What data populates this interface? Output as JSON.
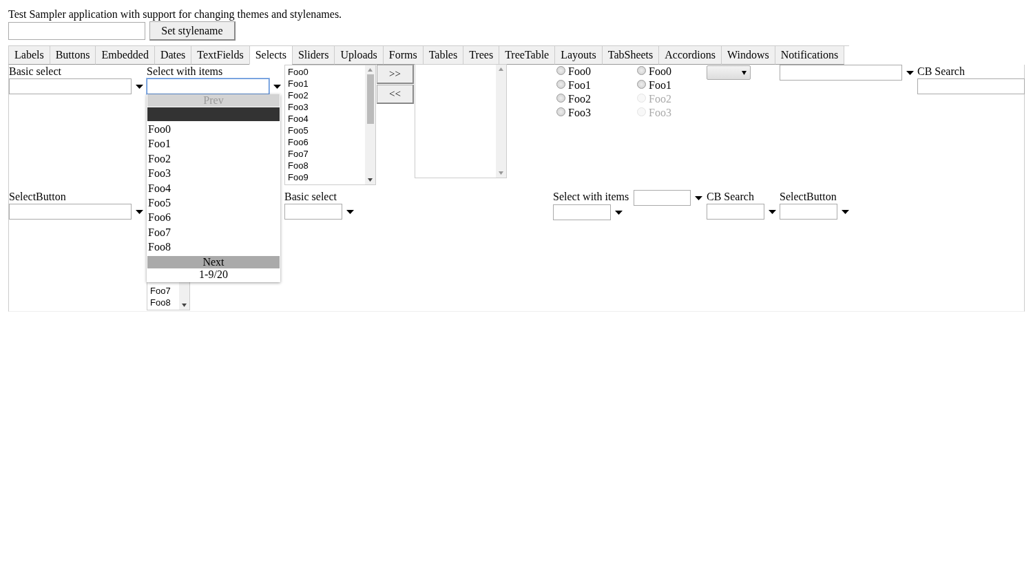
{
  "intro": "Test Sampler application with support for changing themes and stylenames.",
  "set_stylename_button": "Set stylename",
  "tabs": [
    {
      "label": "Labels",
      "selected": false
    },
    {
      "label": "Buttons",
      "selected": false
    },
    {
      "label": "Embedded",
      "selected": false
    },
    {
      "label": "Dates",
      "selected": false
    },
    {
      "label": "TextFields",
      "selected": false
    },
    {
      "label": "Selects",
      "selected": true
    },
    {
      "label": "Sliders",
      "selected": false
    },
    {
      "label": "Uploads",
      "selected": false
    },
    {
      "label": "Forms",
      "selected": false
    },
    {
      "label": "Tables",
      "selected": false
    },
    {
      "label": "Trees",
      "selected": false
    },
    {
      "label": "TreeTable",
      "selected": false
    },
    {
      "label": "Layouts",
      "selected": false
    },
    {
      "label": "TabSheets",
      "selected": false
    },
    {
      "label": "Accordions",
      "selected": false
    },
    {
      "label": "Windows",
      "selected": false
    },
    {
      "label": "Notifications",
      "selected": false
    }
  ],
  "row_1": [
    {
      "kind": "select",
      "caption": "Basic select",
      "focused": false
    },
    {
      "kind": "select",
      "caption": "Select with items",
      "focused": true,
      "popup": {
        "prev": {
          "label": "Prev",
          "disabled": true
        },
        "items": [
          {
            "selected": true
          },
          {
            "label": "Foo0",
            "selected": false
          },
          {
            "label": "Foo1",
            "selected": false
          },
          {
            "label": "Foo2",
            "selected": false
          },
          {
            "label": "Foo3",
            "selected": false
          },
          {
            "label": "Foo4",
            "selected": false
          },
          {
            "label": "Foo5",
            "selected": false
          },
          {
            "label": "Foo6",
            "selected": false
          },
          {
            "label": "Foo7",
            "selected": false
          },
          {
            "label": "Foo8",
            "selected": false
          }
        ],
        "next": {
          "label": "Next",
          "disabled": false
        },
        "status": "1-9/20"
      }
    },
    {
      "kind": "listbox",
      "items": [
        "Foo0",
        "Foo1",
        "Foo2",
        "Foo3",
        "Foo4",
        "Foo5",
        "Foo6",
        "Foo7",
        "Foo8",
        "Foo9"
      ]
    },
    {
      "kind": "buttons",
      "buttons": [
        ">>",
        "<<"
      ]
    },
    {
      "kind": "listbox"
    },
    {
      "kind": "radio_group",
      "options": [
        {
          "label": "Foo0",
          "checked": false,
          "disabled": false
        },
        {
          "label": "Foo1",
          "checked": false,
          "disabled": false
        },
        {
          "label": "Foo2",
          "checked": false,
          "disabled": false
        },
        {
          "label": "Foo3",
          "checked": false,
          "disabled": false
        }
      ]
    },
    {
      "kind": "radio_group",
      "options": [
        {
          "label": "Foo0",
          "checked": false,
          "disabled": false
        },
        {
          "label": "Foo1",
          "checked": false,
          "disabled": false
        },
        {
          "label": "Foo2",
          "checked": false,
          "disabled": true
        },
        {
          "label": "Foo3",
          "checked": false,
          "disabled": true
        }
      ]
    },
    {
      "kind": "native_select"
    },
    {
      "kind": "select",
      "focused": false
    },
    {
      "kind": "select",
      "caption": "CB Search",
      "focused": false,
      "arrow": false
    }
  ],
  "row_2": [
    {
      "kind": "select",
      "caption": "SelectButton",
      "focused": false
    },
    {
      "kind": "listbox",
      "items": [
        "Foo7",
        "Foo8"
      ]
    },
    {
      "kind": "select",
      "caption": "Basic select",
      "focused": false
    },
    {
      "kind": "select",
      "caption": "Select with items",
      "focused": false
    },
    {
      "kind": "select",
      "focused": false
    },
    {
      "kind": "select",
      "caption": "CB Search",
      "focused": false
    },
    {
      "kind": "select",
      "caption": "SelectButton",
      "focused": false
    }
  ]
}
